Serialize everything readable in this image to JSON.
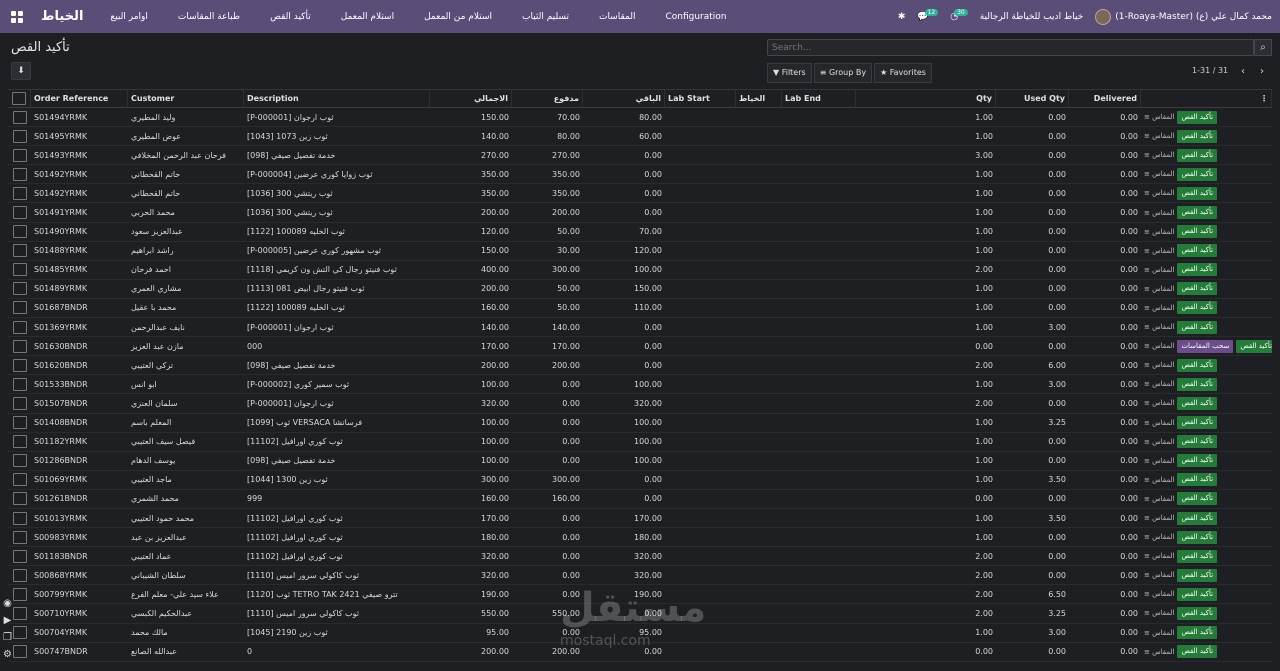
{
  "topbar": {
    "brand": "الخياط",
    "menu": [
      "اوامر البيع",
      "طباعة المقاسات",
      "تأكيد القص",
      "استلام المعمل",
      "استلام من المعمل",
      "تسليم الثياب",
      "المقاسات",
      "Configuration"
    ],
    "company": "خياط اديب للخياطة الرجالية",
    "user": "(1-Roaya-Master) محمد كمال علي (ع)",
    "messages_count": "12",
    "activities_count": "30"
  },
  "page": {
    "title": "تأكيد القص",
    "search_placeholder": "Search...",
    "filters_label": "Filters",
    "groupby_label": "Group By",
    "favorites_label": "Favorites",
    "pager": "1-31 / 31"
  },
  "columns": [
    "Order Reference",
    "Customer",
    "Description",
    "الاجمالي",
    "مدفوع",
    "الباقي",
    "Lab Start",
    "الخياط",
    "Lab End",
    "Qty",
    "Used Qty",
    "Delivered"
  ],
  "actions": {
    "measure": "المقاس",
    "confirm": "تأكيد القص",
    "pull": "سحب المقاسات"
  },
  "rows": [
    [
      "S01494YRMK",
      "وليد المطيري",
      "[P-000001] ثوب ارجوان",
      "150.00",
      "70.00",
      "80.00",
      "",
      "",
      "",
      "1.00",
      "0.00",
      "0.00"
    ],
    [
      "S01495YRMK",
      "عوض المطيري",
      "[1043] ثوب زين 1073",
      "140.00",
      "80.00",
      "60.00",
      "",
      "",
      "",
      "1.00",
      "0.00",
      "0.00"
    ],
    [
      "S01493YRMK",
      "فرحان عبد الرحمن المخلافي",
      "[098] خدمة تفصيل صيفي",
      "270.00",
      "270.00",
      "0.00",
      "",
      "",
      "",
      "3.00",
      "0.00",
      "0.00"
    ],
    [
      "S01492YRMK",
      "حاتم القحطاني",
      "[P-000004] ثوب زوايا كوري عرضين",
      "350.00",
      "350.00",
      "0.00",
      "",
      "",
      "",
      "1.00",
      "0.00",
      "0.00"
    ],
    [
      "S01492YRMK",
      "حاتم القحطاني",
      "[1036] ثوب ريتشي 300",
      "350.00",
      "350.00",
      "0.00",
      "",
      "",
      "",
      "1.00",
      "0.00",
      "0.00"
    ],
    [
      "S01491YRMK",
      "محمد الحربي",
      "[1036] ثوب ريتشي 300",
      "200.00",
      "200.00",
      "0.00",
      "",
      "",
      "",
      "1.00",
      "0.00",
      "0.00"
    ],
    [
      "S01490YRMK",
      "عبدالعزيز سعود",
      "[1122] ثوب الخليه 100089",
      "120.00",
      "50.00",
      "70.00",
      "",
      "",
      "",
      "1.00",
      "0.00",
      "0.00"
    ],
    [
      "S01488YRMK",
      "راشد ابراهيم",
      "[P-000005] ثوب مشهور كوري عرضين",
      "150.00",
      "30.00",
      "120.00",
      "",
      "",
      "",
      "1.00",
      "0.00",
      "0.00"
    ],
    [
      "S01485YRMK",
      "احمد فرحان",
      "[1118] ثوب فنيتو رجال كي التش ون كريمي",
      "400.00",
      "300.00",
      "100.00",
      "",
      "",
      "",
      "2.00",
      "0.00",
      "0.00"
    ],
    [
      "S01489YRMK",
      "مشاري العمري",
      "[1113] ثوب فنيتو رجال ابيض 081",
      "200.00",
      "50.00",
      "150.00",
      "",
      "",
      "",
      "1.00",
      "0.00",
      "0.00"
    ],
    [
      "S01687BNDR",
      "محمد با عقيل",
      "[1122] ثوب الخليه 100089",
      "160.00",
      "50.00",
      "110.00",
      "",
      "",
      "",
      "1.00",
      "0.00",
      "0.00"
    ],
    [
      "S01369YRMK",
      "نايف عبدالرحمن",
      "[P-000001] ثوب ارجوان",
      "140.00",
      "140.00",
      "0.00",
      "",
      "",
      "",
      "1.00",
      "3.00",
      "0.00"
    ],
    [
      "S01630BNDR",
      "مازن عبد العزيز",
      "000",
      "170.00",
      "170.00",
      "0.00",
      "",
      "",
      "",
      "0.00",
      "0.00",
      "0.00"
    ],
    [
      "S01620BNDR",
      "تركي العتيبي",
      "[098] خدمة تفصيل صيفي",
      "200.00",
      "200.00",
      "0.00",
      "",
      "",
      "",
      "2.00",
      "6.00",
      "0.00"
    ],
    [
      "S01533BNDR",
      "ابو انس",
      "[P-000002] ثوب سمير كوري",
      "100.00",
      "0.00",
      "100.00",
      "",
      "",
      "",
      "1.00",
      "3.00",
      "0.00"
    ],
    [
      "S01507BNDR",
      "سلمان العنزي",
      "[P-000001] ثوب ارجوان",
      "320.00",
      "0.00",
      "320.00",
      "",
      "",
      "",
      "2.00",
      "0.00",
      "0.00"
    ],
    [
      "S01408BNDR",
      "المعلم باسم",
      "[1099] ثوب VERSACA فرساتشا",
      "100.00",
      "0.00",
      "100.00",
      "",
      "",
      "",
      "1.00",
      "3.25",
      "0.00"
    ],
    [
      "S01182YRMK",
      "فيصل سيف العتيبي",
      "[11102] ثوب كوري اورافيل",
      "100.00",
      "0.00",
      "100.00",
      "",
      "",
      "",
      "1.00",
      "0.00",
      "0.00"
    ],
    [
      "S01286BNDR",
      "يوسف الدهام",
      "[098] خدمة تفصيل صيفي",
      "100.00",
      "0.00",
      "100.00",
      "",
      "",
      "",
      "1.00",
      "0.00",
      "0.00"
    ],
    [
      "S01069YRMK",
      "ماجد العتيبي",
      "[1044] ثوب زين 1300",
      "300.00",
      "300.00",
      "0.00",
      "",
      "",
      "",
      "1.00",
      "3.50",
      "0.00"
    ],
    [
      "S01261BNDR",
      "محمد الشمري",
      "999",
      "160.00",
      "160.00",
      "0.00",
      "",
      "",
      "",
      "0.00",
      "0.00",
      "0.00"
    ],
    [
      "S01013YRMK",
      "محمد حمود العتيبي",
      "[11102] ثوب كوري اورافيل",
      "170.00",
      "0.00",
      "170.00",
      "",
      "",
      "",
      "1.00",
      "3.50",
      "0.00"
    ],
    [
      "S00983YRMK",
      "عبدالعزيز بن عبد",
      "[11102] ثوب كوري اورافيل",
      "180.00",
      "0.00",
      "180.00",
      "",
      "",
      "",
      "1.00",
      "0.00",
      "0.00"
    ],
    [
      "S01183BNDR",
      "عماد العتيبي",
      "[11102] ثوب كوري اورافيل",
      "320.00",
      "0.00",
      "320.00",
      "",
      "",
      "",
      "2.00",
      "0.00",
      "0.00"
    ],
    [
      "S00868YRMK",
      "سلطان الشيباني",
      "[1110] ثوب كاكولي سرور اميس",
      "320.00",
      "0.00",
      "320.00",
      "",
      "",
      "",
      "2.00",
      "0.00",
      "0.00"
    ],
    [
      "S00799YRMK",
      "علاء سيد علي- معلم الفرع",
      "[1120] ثوب TETRO TAK 2421 تترو صيفي",
      "190.00",
      "0.00",
      "190.00",
      "",
      "",
      "",
      "2.00",
      "6.50",
      "0.00"
    ],
    [
      "S00710YRMK",
      "عبدالحكيم الكبسي",
      "[1110] ثوب كاكولي سرور اميس",
      "550.00",
      "550.00",
      "0.00",
      "",
      "",
      "",
      "2.00",
      "3.25",
      "0.00"
    ],
    [
      "S00704YRMK",
      "مالك محمد",
      "[1045] ثوب زين 2190",
      "95.00",
      "0.00",
      "95.00",
      "",
      "",
      "",
      "1.00",
      "3.00",
      "0.00"
    ],
    [
      "S00747BNDR",
      "عبدالله الصانع",
      "0",
      "200.00",
      "200.00",
      "0.00",
      "",
      "",
      "",
      "0.00",
      "0.00",
      "0.00"
    ]
  ],
  "watermark": {
    "main": "مستقل",
    "sub": "mostaql.com"
  }
}
